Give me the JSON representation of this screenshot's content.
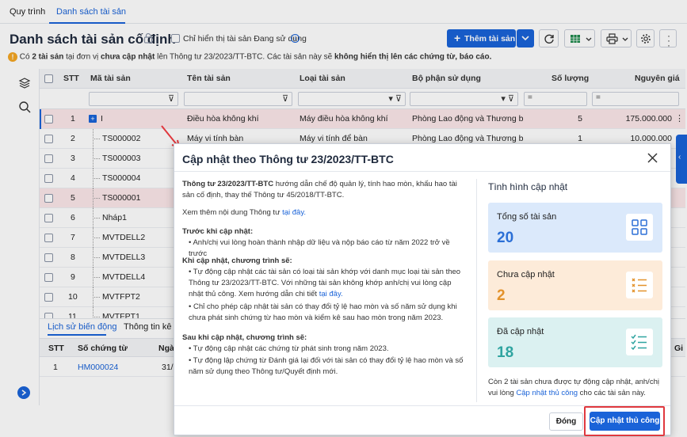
{
  "tabs": [
    {
      "label": "Quy trình"
    },
    {
      "label": "Danh sách tài sản"
    }
  ],
  "header": {
    "title": "Danh sách tài sản cố định",
    "in_use_only_label": "Chỉ hiển thị tài sản Đang sử dụng",
    "add_button_label": "Thêm tài sản"
  },
  "warning": {
    "p1": "Có ",
    "count": "2 tài sản",
    "p2": " tại đơn vị ",
    "p3": "chưa cập nhật",
    "p4": " lên Thông tư 23/2023/TT-BTC. Các tài sản này sẽ ",
    "p5": "không hiển thị lên các chứng từ, báo cáo."
  },
  "table": {
    "columns": [
      "STT",
      "Mã tài sản",
      "Tên tài sản",
      "Loại tài sản",
      "Bộ phận sử dụng",
      "Số lượng",
      "Nguyên giá"
    ],
    "rows": [
      {
        "stt": "1",
        "code": "I",
        "name": "Điều hòa không khí",
        "type": "Máy điều hòa không khí",
        "dept": "Phòng Lao động và Thương bin...",
        "qty": "5",
        "price": "175.000.000"
      },
      {
        "stt": "2",
        "code": "TS000002",
        "name": "Máy vi tính bàn",
        "type": "Máy vi tính để bàn",
        "dept": "Phòng Lao động và Thương bin...",
        "qty": "1",
        "price": "10.000.000"
      },
      {
        "stt": "3",
        "code": "TS000003",
        "name": "",
        "type": "",
        "dept": "",
        "qty": "",
        "price": ""
      },
      {
        "stt": "4",
        "code": "TS000004",
        "name": "",
        "type": "",
        "dept": "",
        "qty": "",
        "price": ""
      },
      {
        "stt": "5",
        "code": "TS000001",
        "name": "",
        "type": "",
        "dept": "",
        "qty": "",
        "price": ""
      },
      {
        "stt": "6",
        "code": "Nháp1",
        "name": "",
        "type": "",
        "dept": "",
        "qty": "",
        "price": ""
      },
      {
        "stt": "7",
        "code": "MVTDELL2",
        "name": "",
        "type": "",
        "dept": "",
        "qty": "",
        "price": ""
      },
      {
        "stt": "8",
        "code": "MVTDELL3",
        "name": "",
        "type": "",
        "dept": "",
        "qty": "",
        "price": ""
      },
      {
        "stt": "9",
        "code": "MVTDELL4",
        "name": "",
        "type": "",
        "dept": "",
        "qty": "",
        "price": ""
      },
      {
        "stt": "10",
        "code": "MVTFPT2",
        "name": "",
        "type": "",
        "dept": "",
        "qty": "",
        "price": ""
      },
      {
        "stt": "11",
        "code": "MVTFPT1",
        "name": "",
        "type": "",
        "dept": "",
        "qty": "",
        "price": ""
      }
    ]
  },
  "bottom": {
    "tabs": [
      "Lịch sử biến động",
      "Thông tin kê khai"
    ],
    "columns": [
      "STT",
      "Số chứng từ",
      "Ngày"
    ],
    "rows": [
      {
        "stt": "1",
        "doc": "HM000024",
        "date": "31/"
      }
    ],
    "extra_col": "Gi"
  },
  "dialog": {
    "title": "Cập nhật theo Thông tư 23/2023/TT-BTC",
    "intro_bold": "Thông tư 23/2023/TT-BTC",
    "intro_rest": " hướng dẫn chế độ quản lý, tính hao mòn, khấu hao tài sản cố định, thay thế Thông tư 45/2018/TT-BTC.",
    "see_more": "Xem thêm nội dung Thông tư ",
    "see_more_link": "tại đây.",
    "before_title": "Trước khi cập nhật:",
    "before_item": "Anh/chị vui lòng hoàn thành nhập dữ liệu và nộp báo cáo từ năm 2022 trở về trước",
    "during_title": "Khi cập nhật, chương trình sẽ:",
    "during_item1": "Tự động cập nhật các tài sản có loại tài sản khớp với danh mục loại tài sản theo Thông tư 23/2023/TT-BTC. Với những tài sản không khớp anh/chị vui lòng cập nhật thủ công. Xem hướng dẫn chi tiết ",
    "during_item1_link": "tại đây.",
    "during_item2": "Chỉ cho phép cập nhật tài sản có thay đổi tỷ lệ hao mòn và số năm sử dụng khi chưa phát sinh chứng từ hao mòn và kiểm kê sau hao mòn trong năm 2023.",
    "after_title": "Sau khi cập nhật, chương trình sẽ:",
    "after_item1": "Tự động cập nhật các chứng từ phát sinh trong năm 2023.",
    "after_item2": "Tự động lập chứng từ Đánh giá lại đối với tài sản có thay đổi tỷ lệ hao mòn và số năm sử dụng theo Thông tư/Quyết định mới.",
    "status_title": "Tình hình cập nhật",
    "cards": [
      {
        "label": "Tổng số tài sản",
        "value": "20",
        "color": "#2b6fd6",
        "bg": "#dbe9fb"
      },
      {
        "label": "Chưa cập nhật",
        "value": "2",
        "color": "#e3922b",
        "bg": "#fdebd9"
      },
      {
        "label": "Đã cập nhật",
        "value": "18",
        "color": "#2fa4a0",
        "bg": "#dbf1f1"
      }
    ],
    "note1": "Còn 2 tài sản chưa được tự động cập nhật, anh/chị vui lòng ",
    "note_link": "Cập nhật thủ công",
    "note2": " cho các tài sản này.",
    "close_label": "Đóng",
    "manual_label": "Cập nhật thủ công"
  },
  "colors": {
    "accent": "#1a63d8",
    "highlight": "#e0383e",
    "pink_row": "#fce8ea"
  }
}
